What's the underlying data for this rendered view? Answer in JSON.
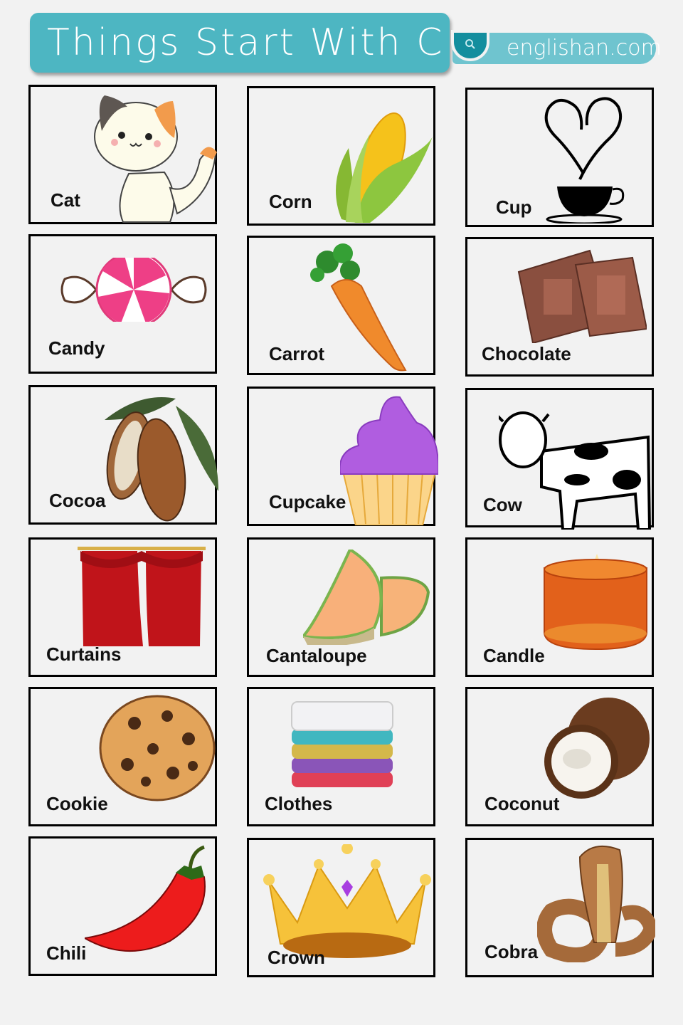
{
  "header": {
    "title": "Things Start With C",
    "site": "englishan.com",
    "site_icon": "search-icon",
    "colors": {
      "title_bg": "#4db6c2",
      "site_bg": "#6fc4cf",
      "site_icon_bg": "#148e9e"
    }
  },
  "cards": [
    {
      "label": "Cat",
      "icon": "cat-icon"
    },
    {
      "label": "Corn",
      "icon": "corn-icon"
    },
    {
      "label": "Cup",
      "icon": "cup-icon"
    },
    {
      "label": "Candy",
      "icon": "candy-icon"
    },
    {
      "label": "Carrot",
      "icon": "carrot-icon"
    },
    {
      "label": "Chocolate",
      "icon": "chocolate-icon"
    },
    {
      "label": "Cocoa",
      "icon": "cocoa-icon"
    },
    {
      "label": "Cupcake",
      "icon": "cupcake-icon"
    },
    {
      "label": "Cow",
      "icon": "cow-icon"
    },
    {
      "label": "Curtains",
      "icon": "curtains-icon"
    },
    {
      "label": "Cantaloupe",
      "icon": "cantaloupe-icon"
    },
    {
      "label": "Candle",
      "icon": "candle-icon"
    },
    {
      "label": "Cookie",
      "icon": "cookie-icon"
    },
    {
      "label": "Clothes",
      "icon": "clothes-icon"
    },
    {
      "label": "Coconut",
      "icon": "coconut-icon"
    },
    {
      "label": "Chili",
      "icon": "chili-icon"
    },
    {
      "label": "Crown",
      "icon": "crown-icon"
    },
    {
      "label": "Cobra",
      "icon": "cobra-icon"
    }
  ]
}
